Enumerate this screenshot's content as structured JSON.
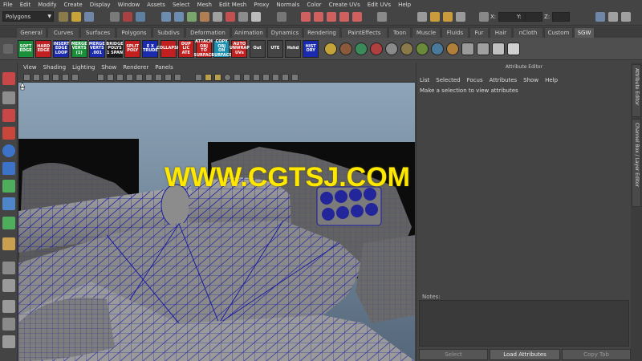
{
  "menu": [
    "File",
    "Edit",
    "Modify",
    "Create",
    "Display",
    "Window",
    "Assets",
    "Select",
    "Mesh",
    "Edit Mesh",
    "Proxy",
    "Normals",
    "Color",
    "Create UVs",
    "Edit UVs",
    "Help"
  ],
  "status_line": {
    "mode": "Polygons",
    "x_label": "X:",
    "y_label": "Y:",
    "z_label": "Z:"
  },
  "shelf_tabs": [
    "General",
    "Curves",
    "Surfaces",
    "Polygons",
    "Subdivs",
    "Deformation",
    "Animation",
    "Dynamics",
    "Rendering",
    "PaintEffects",
    "Toon",
    "Muscle",
    "Fluids",
    "Fur",
    "Hair",
    "nCloth",
    "Custom",
    "SGW"
  ],
  "active_shelf_tab": "SGW",
  "shelf_buttons": [
    {
      "label": "SOFT\nEDGE",
      "color": "#1a8f3a"
    },
    {
      "label": "HARD\nEDGE",
      "color": "#c22020"
    },
    {
      "label": "INSERT\nEDGE\nLOOP",
      "color": "#1b2bb0"
    },
    {
      "label": "MERGE\nVERTS\n(1)",
      "color": "#1a8f3a"
    },
    {
      "label": "MERGE\nVERTS\n.001",
      "color": "#1b2bb0"
    },
    {
      "label": "BRIDGE\nPOLYS\n1 SPAN",
      "color": "#1b1b1b"
    },
    {
      "label": "SPLIT\nPOLY",
      "color": "#c22020"
    },
    {
      "label": "E X\nTRUDE",
      "color": "#1b2bb0"
    },
    {
      "label": "COLLAPSE",
      "color": "#c22020"
    },
    {
      "label": "DUP\nLIC\nATE",
      "color": "#c22020"
    },
    {
      "label": "ATTACH\nOBJ\nTO\nSURFACE",
      "color": "#c22020"
    },
    {
      "label": "COPY\nOBJ\nON\nSURFACE",
      "color": "#1b8fb0"
    },
    {
      "label": "AUTO\nUNWRAP\nUVs",
      "color": "#c22020"
    },
    {
      "label": "Out",
      "color": "#444444"
    },
    {
      "label": "UTE",
      "color": "#444444"
    },
    {
      "label": "Hshd",
      "color": "#444444"
    },
    {
      "label": "HIST\nORY",
      "color": "#1b2bb0"
    }
  ],
  "viewport": {
    "menu": [
      "View",
      "Shading",
      "Lighting",
      "Show",
      "Renderer",
      "Panels"
    ]
  },
  "watermark": "WWW.CGTSJ.COM",
  "attribute_editor": {
    "title": "Attribute Editor",
    "menu": [
      "List",
      "Selected",
      "Focus",
      "Attributes",
      "Show",
      "Help"
    ],
    "message": "Make a selection to view attributes",
    "notes_label": "Notes:",
    "buttons": {
      "select": "Select",
      "load": "Load Attributes",
      "copy": "Copy Tab"
    }
  },
  "side_tabs": {
    "attribute_editor": "Attribute Editor",
    "channel_box": "Channel Box / Layer Editor"
  },
  "colors": {
    "wire": "#1c1ea0",
    "mesh": "#8c8c8c",
    "bg_top": "#8ea4b8",
    "accent": "#ffe800"
  }
}
